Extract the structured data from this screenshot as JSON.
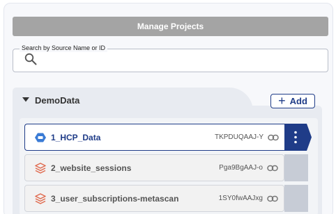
{
  "header": {
    "manage_label": "Manage Projects"
  },
  "search": {
    "label": "Search by Source Name or ID",
    "value": "",
    "placeholder": ""
  },
  "group": {
    "name": "DemoData",
    "add_label": "Add"
  },
  "rows": [
    {
      "name": "1_HCP_Data",
      "id": "TKPDUQAAJ-Y",
      "icon": "cube-icon",
      "selected": true
    },
    {
      "name": "2_website_sessions",
      "id": "Pga9BgAAJ-o",
      "icon": "stack-icon",
      "selected": false
    },
    {
      "name": "3_user_subscriptions-metascan",
      "id": "1SY0fwAAJxg",
      "icon": "stack-icon",
      "selected": false
    }
  ],
  "colors": {
    "accent": "#1f3c88",
    "stack_icon": "#e06a4e",
    "cube_icon": "#3a7bd5"
  }
}
